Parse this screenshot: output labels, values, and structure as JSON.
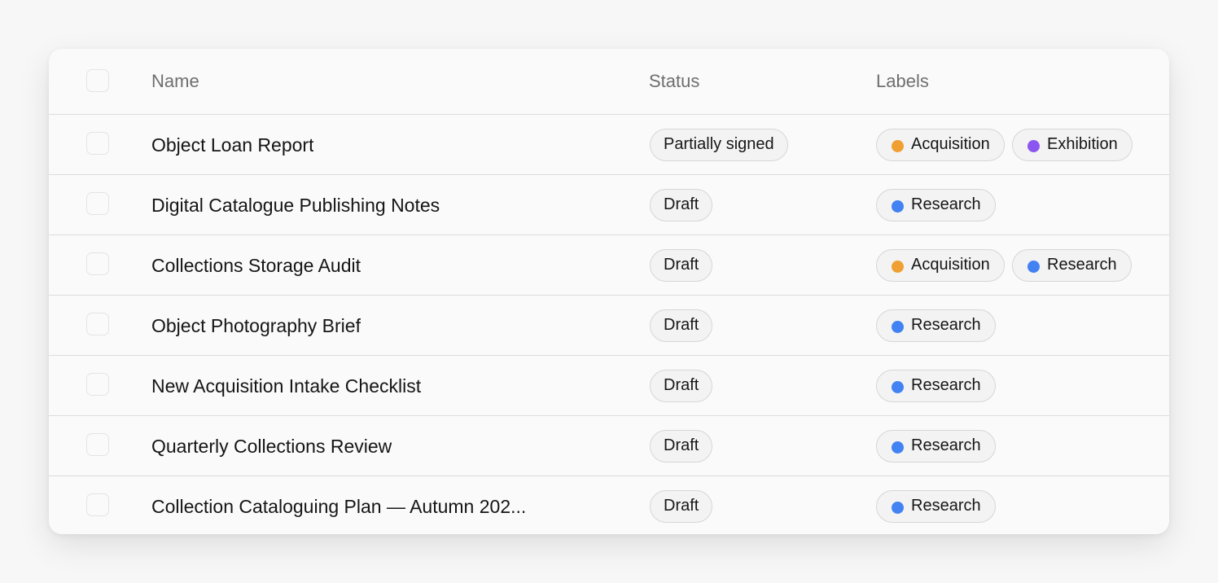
{
  "header": {
    "name": "Name",
    "status": "Status",
    "labels": "Labels"
  },
  "label_colors": {
    "Acquisition": "#f0a033",
    "Exhibition": "#8b55f0",
    "Research": "#4282f2"
  },
  "rows": [
    {
      "name": "Object Loan Report",
      "status": "Partially signed",
      "labels": [
        "Acquisition",
        "Exhibition"
      ]
    },
    {
      "name": "Digital Catalogue Publishing Notes",
      "status": "Draft",
      "labels": [
        "Research"
      ]
    },
    {
      "name": "Collections Storage Audit",
      "status": "Draft",
      "labels": [
        "Acquisition",
        "Research"
      ]
    },
    {
      "name": "Object Photography Brief",
      "status": "Draft",
      "labels": [
        "Research"
      ]
    },
    {
      "name": "New Acquisition Intake Checklist",
      "status": "Draft",
      "labels": [
        "Research"
      ]
    },
    {
      "name": "Quarterly Collections Review",
      "status": "Draft",
      "labels": [
        "Research"
      ]
    },
    {
      "name": "Collection Cataloguing Plan — Autumn 202...",
      "status": "Draft",
      "labels": [
        "Research"
      ]
    }
  ]
}
